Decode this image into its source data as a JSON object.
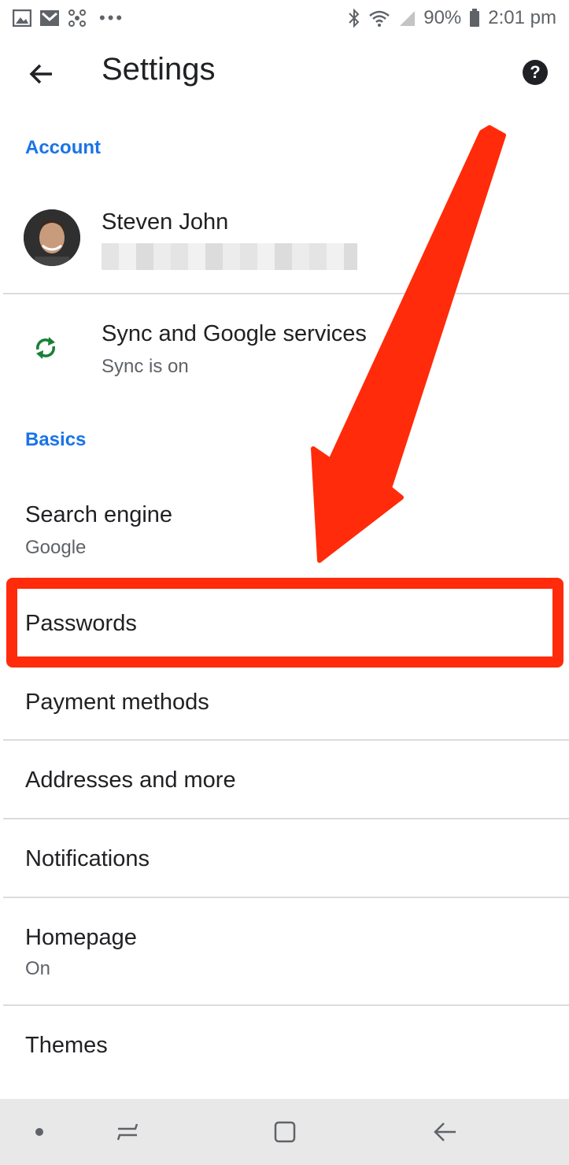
{
  "status_bar": {
    "battery": "90%",
    "time": "2:01 pm",
    "icons": [
      "gallery-icon",
      "gmail-icon",
      "network-icon",
      "more-dots-icon",
      "bluetooth-icon",
      "wifi-icon",
      "signal-icon",
      "battery-icon"
    ]
  },
  "app_bar": {
    "title": "Settings",
    "help_icon": "?"
  },
  "sections": {
    "account": "Account",
    "basics": "Basics"
  },
  "account": {
    "name": "Steven John"
  },
  "sync": {
    "title": "Sync and Google services",
    "subtitle": "Sync is on"
  },
  "search_engine": {
    "title": "Search engine",
    "subtitle": "Google"
  },
  "passwords": {
    "title": "Passwords"
  },
  "payment_methods": {
    "title": "Payment methods"
  },
  "addresses": {
    "title": "Addresses and more"
  },
  "notifications": {
    "title": "Notifications"
  },
  "homepage": {
    "title": "Homepage",
    "subtitle": "On"
  },
  "themes": {
    "title": "Themes"
  },
  "colors": {
    "accent": "#1a73e8",
    "sync_green": "#188038",
    "annotation_red": "#ff2b0a",
    "divider": "#dadce0"
  }
}
